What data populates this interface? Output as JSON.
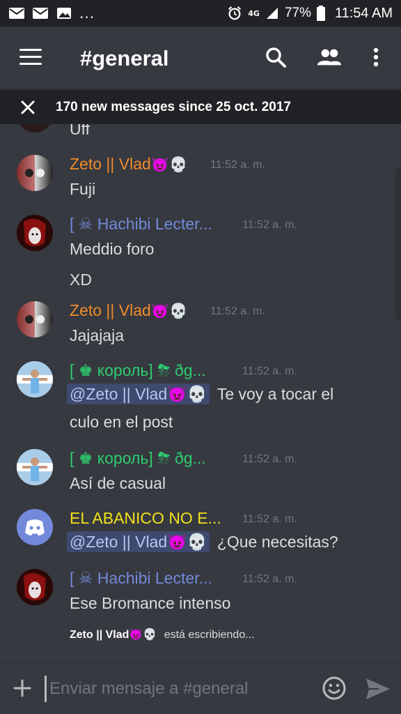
{
  "status_bar": {
    "network": "4G",
    "battery": "77%",
    "time": "11:54 AM",
    "more": "..."
  },
  "header": {
    "channel": "#general"
  },
  "new_messages_bar": {
    "text": "170 new messages since 25 oct. 2017"
  },
  "messages": [
    {
      "author": "",
      "color": "#dcddde",
      "time": "",
      "lines": [
        "Uff"
      ]
    },
    {
      "author": "Zeto || Vlad",
      "author_suffix": "😈💀",
      "color": "#f28b2c",
      "time": "11:52 a. m.",
      "lines": [
        "Fuji"
      ]
    },
    {
      "author": "[ ☠ Hachibi Lecter...",
      "color": "#7289da",
      "time": "11:52 a. m.",
      "lines": [
        "Meddio foro",
        "XD"
      ]
    },
    {
      "author": "Zeto || Vlad",
      "author_suffix": "😈💀",
      "color": "#f28b2c",
      "time": "11:52 a. m.",
      "lines": [
        "Jajajaja"
      ]
    },
    {
      "author": "[ ♚ король]  ⛈ ðg...",
      "color": "#2ecc71",
      "time": "11:52 a. m.",
      "mention": "@Zeto || Vlad😈💀",
      "lines": [
        "Te voy a tocar el",
        "culo en el post"
      ]
    },
    {
      "author": "[ ♚ король]  ⛈ ðg...",
      "color": "#2ecc71",
      "time": "11:52 a. m.",
      "lines": [
        "Así de casual"
      ]
    },
    {
      "author": "EL ABANICO NO E...",
      "color": "#f1e11a",
      "time": "11:52 a. m.",
      "mention": "@Zeto || Vlad😈💀",
      "lines": [
        "¿Que necesitas?"
      ]
    },
    {
      "author": "[ ☠ Hachibi Lecter...",
      "color": "#7289da",
      "time": "11:52 a. m.",
      "lines": [
        "Ese Bromance intenso"
      ]
    }
  ],
  "typing": {
    "user": "Zeto || Vlad😈💀",
    "text": "está escribiendo..."
  },
  "input": {
    "placeholder": "Enviar mensaje a #general"
  },
  "icons": {
    "menu": "hamburger-icon",
    "search": "search-icon",
    "members": "members-icon",
    "more": "more-vertical-icon",
    "close": "close-icon",
    "plus": "plus-icon",
    "emoji": "emoji-icon",
    "send": "send-icon"
  }
}
